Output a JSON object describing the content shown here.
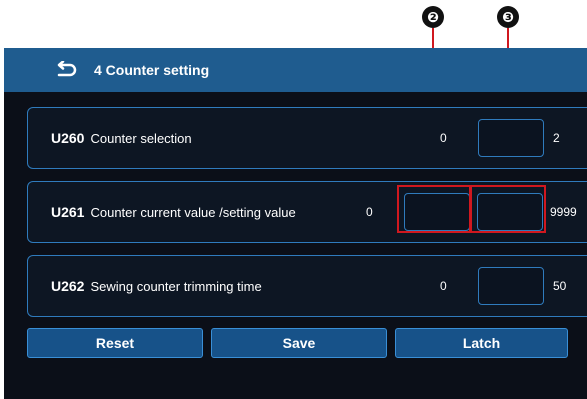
{
  "callouts": {
    "two": "❷",
    "three": "❸"
  },
  "header": {
    "title": "4 Counter setting",
    "back_icon": "return-arrow-icon"
  },
  "rows": [
    {
      "code": "U260",
      "name": "Counter selection",
      "min": "0",
      "value": "",
      "max": "2"
    },
    {
      "code": "U261",
      "name": "Counter current value /setting value",
      "min": "0",
      "current_value": "",
      "setting_value": "",
      "max": "9999"
    },
    {
      "code": "U262",
      "name": "Sewing counter trimming time",
      "min": "0",
      "value": "",
      "max": "50"
    }
  ],
  "buttons": {
    "reset": "Reset",
    "save": "Save",
    "latch": "Latch"
  },
  "colors": {
    "title_bar": "#1f5c8f",
    "screen_bg": "#0b0f18",
    "accent_border": "#2f7bbd",
    "button_bg": "#175289",
    "callout_red": "#d0181f"
  }
}
